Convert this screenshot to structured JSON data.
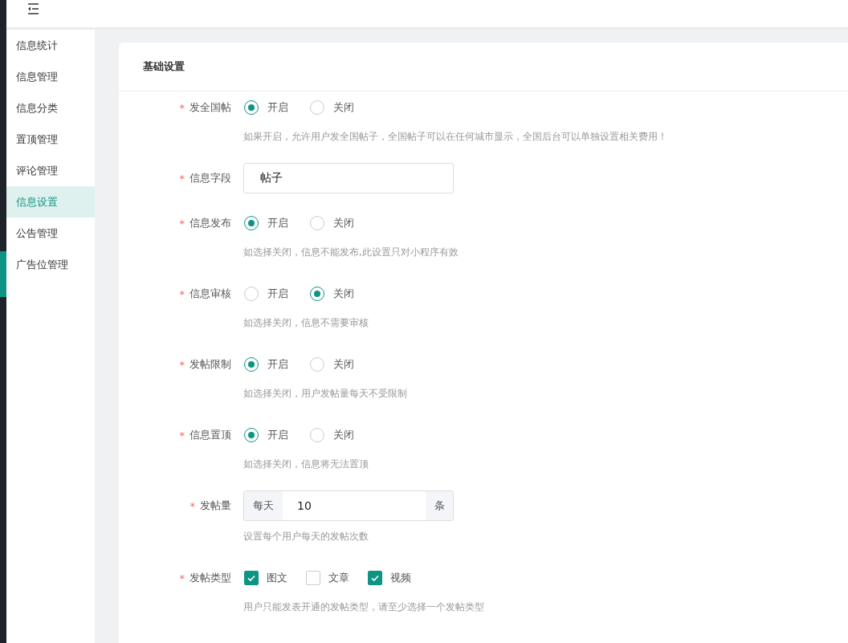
{
  "topbar": {
    "menu_toggle": true
  },
  "sidebar": {
    "items": [
      {
        "label": "信息统计",
        "selected": false
      },
      {
        "label": "信息管理",
        "selected": false
      },
      {
        "label": "信息分类",
        "selected": false
      },
      {
        "label": "置顶管理",
        "selected": false
      },
      {
        "label": "评论管理",
        "selected": false
      },
      {
        "label": "信息设置",
        "selected": true
      },
      {
        "label": "公告管理",
        "selected": false
      },
      {
        "label": "广告位管理",
        "selected": false
      }
    ]
  },
  "card": {
    "title": "基础设置",
    "fields": [
      {
        "kind": "radio",
        "label": "发全国帖",
        "required_mark": "*",
        "options": [
          {
            "label": "开启",
            "selected": true
          },
          {
            "label": "关闭",
            "selected": false
          }
        ],
        "hint": "如果开启，允许用户发全国帖子，全国帖子可以在任何城市显示，全国后台可以单独设置相关费用！"
      },
      {
        "kind": "text",
        "label": "信息字段",
        "required_mark": "*",
        "value": "帖子"
      },
      {
        "kind": "radio",
        "label": "信息发布",
        "required_mark": "*",
        "options": [
          {
            "label": "开启",
            "selected": true
          },
          {
            "label": "关闭",
            "selected": false
          }
        ],
        "hint": "如选择关闭，信息不能发布,此设置只对小程序有效"
      },
      {
        "kind": "radio",
        "label": "信息审核",
        "required_mark": "*",
        "options": [
          {
            "label": "开启",
            "selected": false
          },
          {
            "label": "关闭",
            "selected": true
          }
        ],
        "hint": "如选择关闭，信息不需要审核"
      },
      {
        "kind": "radio",
        "label": "发帖限制",
        "required_mark": "*",
        "options": [
          {
            "label": "开启",
            "selected": true
          },
          {
            "label": "关闭",
            "selected": false
          }
        ],
        "hint": "如选择关闭，用户发帖量每天不受限制"
      },
      {
        "kind": "radio",
        "label": "信息置顶",
        "required_mark": "*",
        "options": [
          {
            "label": "开启",
            "selected": true
          },
          {
            "label": "关闭",
            "selected": false
          }
        ],
        "hint": "如选择关闭，信息将无法置顶"
      },
      {
        "kind": "addon",
        "label": "发帖量",
        "required_mark": "*",
        "prefix": "每天",
        "value": "10",
        "suffix": "条",
        "hint": "设置每个用户每天的发帖次数"
      },
      {
        "kind": "checkbox",
        "label": "发帖类型",
        "required_mark": "*",
        "options": [
          {
            "label": "图文",
            "checked": true
          },
          {
            "label": "文章",
            "checked": false
          },
          {
            "label": "视频",
            "checked": true
          }
        ],
        "hint": "用户只能发表开通的发帖类型，请至少选择一个发帖类型"
      }
    ]
  }
}
